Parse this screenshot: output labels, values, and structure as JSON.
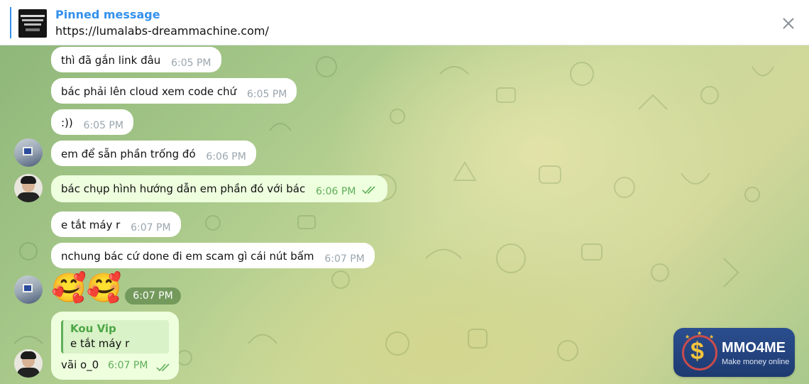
{
  "pinned": {
    "title": "Pinned message",
    "text": "https://lumalabs-dreammachine.com/"
  },
  "messages": [
    {
      "text": "thì đã gắn link đâu",
      "time": "6:05 PM"
    },
    {
      "text": "bác phải lên cloud xem code chứ",
      "time": "6:05 PM"
    },
    {
      "text": ":))",
      "time": "6:05 PM"
    },
    {
      "text": "em để sẵn phần trống đó",
      "time": "6:06 PM"
    },
    {
      "text": "bác chụp hình hướng dẫn em phần đó với bác",
      "time": "6:06 PM",
      "outgoing": true
    },
    {
      "text": "e tắt máy r",
      "time": "6:07 PM"
    },
    {
      "text": "nchung bác cứ done đi em scam gì cái nút bấm",
      "time": "6:07 PM"
    }
  ],
  "emoji_message": {
    "emojis": "🥰🥰",
    "time": "6:07 PM"
  },
  "reply_message": {
    "quote_author": "Kou Vip",
    "quote_text": "e tắt máy r",
    "text": "vãi o_0",
    "time": "6:07 PM"
  },
  "watermark": {
    "name": "MMO4ME",
    "tagline": "Make money online"
  },
  "colors": {
    "accent": "#3390ec",
    "outgoing_bubble": "#eeffde",
    "read_tick": "#5fae5a"
  },
  "icons": {
    "close": "close-icon",
    "read_receipt": "double-check-icon"
  }
}
